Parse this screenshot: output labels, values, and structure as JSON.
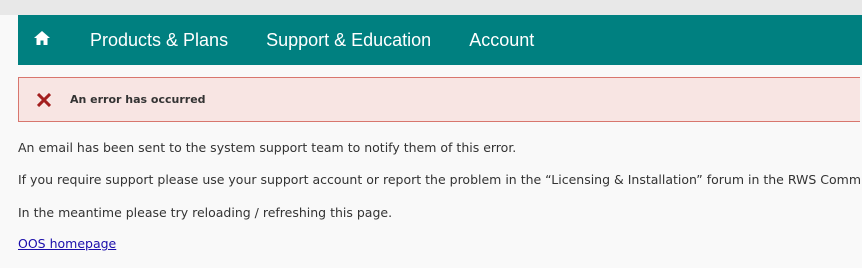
{
  "nav": {
    "home_icon": "home-icon",
    "items": [
      {
        "label": "Products & Plans"
      },
      {
        "label": "Support & Education"
      },
      {
        "label": "Account"
      }
    ]
  },
  "error": {
    "icon": "close-icon",
    "title": "An error has occurred",
    "color": "#a31f1f"
  },
  "messages": {
    "line1": "An email has been sent to the system support team to notify them of this error.",
    "line2": "If you require support please use your support account or report the problem in the “Licensing & Installation” forum in the RWS Community.",
    "line3": "In the meantime please try reloading / refreshing this page."
  },
  "link": {
    "label": "OOS homepage"
  },
  "colors": {
    "nav_bg": "#008080",
    "error_bg": "#f8e5e3",
    "error_border": "#d8766e",
    "link": "#1a0dab"
  }
}
